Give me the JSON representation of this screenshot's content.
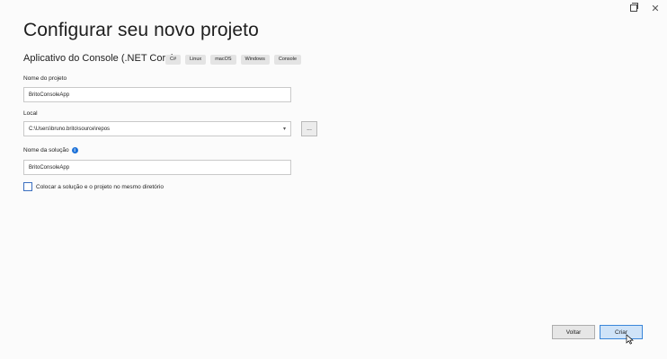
{
  "window": {
    "restore_icon": "restore-icon",
    "close_icon": "close-icon",
    "close_glyph": "✕"
  },
  "page": {
    "title": "Configurar seu novo projeto",
    "template_name": "Aplicativo do Console (.NET Core)",
    "tags": [
      "C#",
      "Linux",
      "macOS",
      "Windows",
      "Console"
    ]
  },
  "form": {
    "project_name_label": "Nome do projeto",
    "project_name_value": "BritoConsoleApp",
    "location_label": "Local",
    "location_value": "C:\\Users\\bruno.brito\\source\\repos",
    "browse_label": "...",
    "solution_name_label": "Nome da solução",
    "solution_name_value": "BritoConsoleApp",
    "same_dir_label": "Colocar a solução e o projeto no mesmo diretório",
    "same_dir_checked": false
  },
  "buttons": {
    "back_label": "Voltar",
    "create_label": "Criar"
  },
  "colors": {
    "accent": "#1c71d8",
    "primary_button_bg": "#cfe3f8",
    "primary_button_border": "#3a86d9"
  }
}
